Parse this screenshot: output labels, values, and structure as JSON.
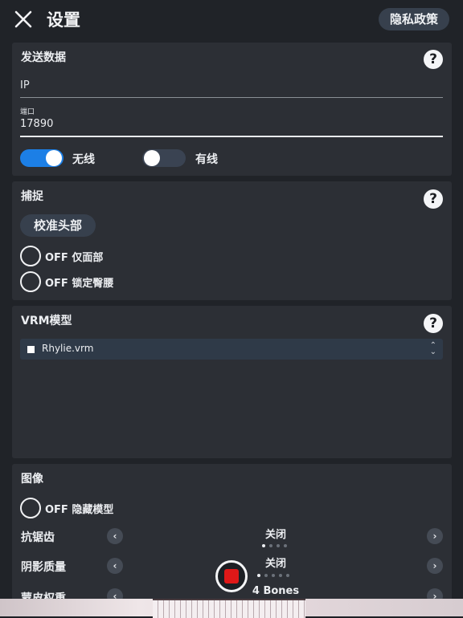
{
  "header": {
    "title": "设置",
    "privacy_label": "隐私政策"
  },
  "send_data": {
    "title": "发送数据",
    "ip_label": "IP",
    "port_label": "端口",
    "port_value": "17890",
    "wireless_label": "无线",
    "wireless_on": true,
    "wired_label": "有线",
    "wired_on": false
  },
  "capture": {
    "title": "捕捉",
    "calibrate_label": "校准头部",
    "options": [
      {
        "state": "OFF",
        "label": "仅面部"
      },
      {
        "state": "OFF",
        "label": "锁定臀腰"
      }
    ]
  },
  "vrm": {
    "title": "VRM模型",
    "selected_model": "Rhylie.vrm"
  },
  "image": {
    "title": "图像",
    "hide_model": {
      "state": "OFF",
      "label": "隐藏模型"
    },
    "rows": [
      {
        "label": "抗锯齿",
        "value": "关闭",
        "page_count": 4,
        "current_page": 1
      },
      {
        "label": "阴影质量",
        "value": "关闭",
        "page_count": 5,
        "current_page": 1
      },
      {
        "label": "蒙皮权重",
        "value": "4 Bones"
      }
    ]
  },
  "icons": {
    "close": "close-icon",
    "help": "help-icon",
    "prev": "chevron-left-icon",
    "next": "chevron-right-icon",
    "record": "record-icon"
  },
  "colors": {
    "accent": "#1c7fe6",
    "record": "#e01818",
    "card": "#2c2f35"
  }
}
